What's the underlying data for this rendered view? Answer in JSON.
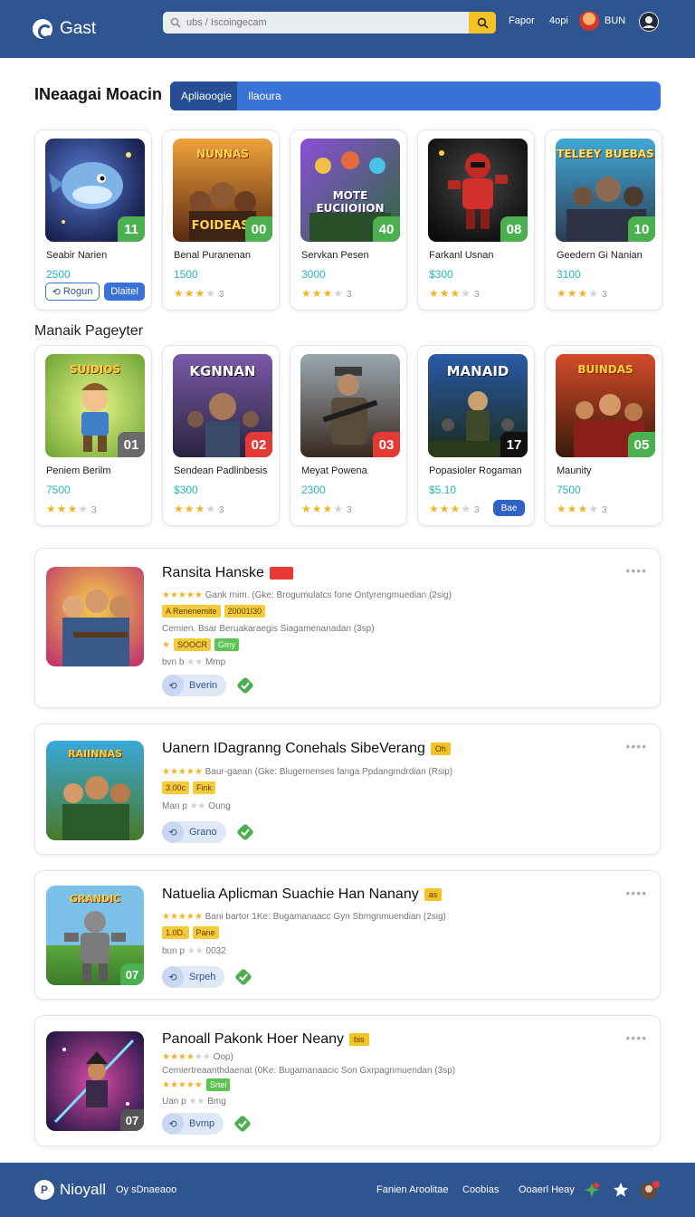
{
  "header": {
    "logo": "Gast",
    "search_placeholder": "ubs / Iscoingecam",
    "nav": [
      "Fapor",
      "4opi",
      "BUN"
    ]
  },
  "main": {
    "title": "INeaagai Moacin",
    "tabs": [
      "Apliaoogie",
      "Ilaoura"
    ],
    "row1": [
      {
        "name": "Seabir Narien",
        "price": "2500",
        "badge": "11",
        "badge_color": "#4caf50",
        "thumb_text": "",
        "buttons": [
          "Rogun",
          "Dlaitel"
        ]
      },
      {
        "name": "Benal Puranenan",
        "price": "1500",
        "badge": "00",
        "badge_color": "#4caf50",
        "thumb_text": "NUNNAS",
        "stars": 3,
        "rating": "3"
      },
      {
        "name": "Servkan Pesen",
        "price": "3000",
        "badge": "40",
        "badge_color": "#4caf50",
        "thumb_text": "MOTE EUCIIOIION",
        "stars": 3,
        "rating": "3"
      },
      {
        "name": "Farkanl Usnan",
        "price": "$300",
        "badge": "08",
        "badge_color": "#4caf50",
        "thumb_text": "",
        "stars": 3,
        "rating": "3"
      },
      {
        "name": "Geedern Gi Nanian",
        "price": "3100",
        "badge": "10",
        "badge_color": "#4caf50",
        "thumb_text": "TELEEY BUEBAS",
        "stars": 3,
        "rating": "3"
      }
    ],
    "subtitle": "Manaik Pageyter",
    "row2": [
      {
        "name": "Peniem Berilm",
        "price": "7500",
        "badge": "01",
        "badge_color": "#6a6a6a",
        "thumb_text": "SUIDIOS",
        "stars": 3,
        "rating": "3"
      },
      {
        "name": "Sendean Padlinbesis",
        "price": "$300",
        "badge": "02",
        "badge_color": "#e53935",
        "thumb_text": "KGNNAN",
        "stars": 3,
        "rating": "3"
      },
      {
        "name": "Meyat Powena",
        "price": "2300",
        "badge": "03",
        "badge_color": "#e53935",
        "thumb_text": "",
        "stars": 3,
        "rating": "3"
      },
      {
        "name": "Popasioler Rogaman",
        "price": "$5.10",
        "badge": "17",
        "badge_color": "#111111",
        "thumb_text": "MANAID",
        "stars": 3,
        "rating": "3",
        "pill": "Bae"
      },
      {
        "name": "Maunity",
        "price": "7500",
        "badge": "05",
        "badge_color": "#4caf50",
        "thumb_text": "BUINDAS",
        "stars": 3,
        "rating": "3"
      }
    ],
    "list": [
      {
        "title": "Ransita Hanske",
        "flag": "",
        "flag_color": "#e53935",
        "line1": "Gank rnim. (Gke: Brogumulatcs fone Ontyrengmuedian (2sig)",
        "tags": [
          "A Renenemite",
          "20001I30"
        ],
        "line2": "Cemien. Bsar Beruakaraegis Siagamenanadan (3sp)",
        "tags2": [
          "SOOCR",
          "Gmy"
        ],
        "meta": "bvn b",
        "meta2": "Mmp",
        "action": "Bverin",
        "thumb_text": ""
      },
      {
        "title": "Uanern IDagranng Conehals SibeVerang",
        "flag": "Oh",
        "flag_color": "#f3c325",
        "line1": "Baur-gaean (Gke: Blugemenses fanga Ppdangmdrdian (Rsip)",
        "tags": [
          "3.00c",
          "Fink"
        ],
        "meta": "Man p",
        "meta2": "Oung",
        "action": "Grano",
        "thumb_text": "RAIINNAS"
      },
      {
        "title": "Natuelia Aplicman Suachie Han Nanany",
        "flag": "as",
        "flag_color": "#f3c325",
        "line1": "Bani bartor 1Ke: Bugamanaacc Gyn Sbmgnmuendian (2sig)",
        "tags": [
          "1.0D.",
          "Pane"
        ],
        "meta": "bun p",
        "meta2": "0032",
        "action": "Srpeh",
        "thumb_text": "GRANDIC",
        "badge": "07"
      },
      {
        "title": "Panoall Pakonk  Hoer Neany",
        "flag": "bis",
        "flag_color": "#f3c325",
        "line1": "Oop)",
        "line1b": "Cemiertreaanthdaenat (0Ke: Bugamanaacic Son Gxrpagnmuendan (3sp)",
        "tags": [
          "Srtel"
        ],
        "meta": "Uan p",
        "meta2": "Bmg",
        "action": "Bvmp",
        "thumb_text": "",
        "badge": "07"
      }
    ]
  },
  "footer": {
    "logo": "Nioyall",
    "tagline": "Oy sDnaeaoo",
    "links": [
      "Fanien Aroolitae",
      "Coobias",
      "Ooaerl Heay"
    ]
  }
}
